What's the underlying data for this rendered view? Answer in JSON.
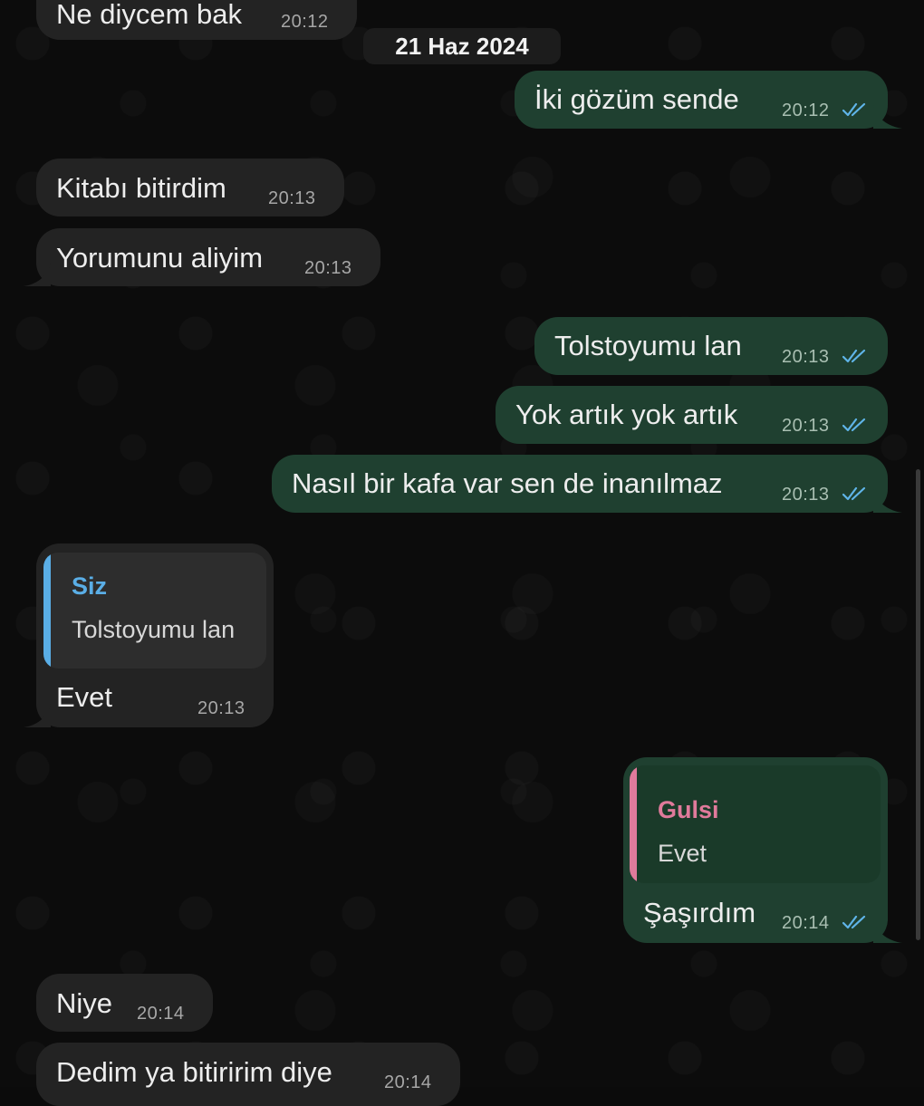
{
  "date_separator": "21 Haz 2024",
  "messages": [
    {
      "text": "Ne diycem bak",
      "time": "20:12"
    },
    {
      "text": "İki gözüm sende",
      "time": "20:12"
    },
    {
      "text": "Kitabı bitirdim",
      "time": "20:13"
    },
    {
      "text": "Yorumunu aliyim",
      "time": "20:13"
    },
    {
      "text": "Tolstoyumu lan",
      "time": "20:13"
    },
    {
      "text": "Yok artık yok artık",
      "time": "20:13"
    },
    {
      "text": "Nasıl bir kafa var sen de inanılmaz",
      "time": "20:13"
    },
    {
      "text": "Evet",
      "time": "20:13",
      "reply_name": "Siz",
      "reply_text": "Tolstoyumu lan"
    },
    {
      "text": "Şaşırdım",
      "time": "20:14",
      "reply_name": "Gulsi",
      "reply_text": "Evet"
    },
    {
      "text": "Niye",
      "time": "20:14"
    },
    {
      "text": "Dedim ya bitiririm diye",
      "time": "20:14"
    }
  ],
  "colors": {
    "incoming_bubble": "#232323",
    "outgoing_bubble": "#1f4030",
    "read_ticks": "#5fb4e8",
    "reply_accent_siz": "#5aaee6",
    "reply_accent_gulsi": "#e07a9b"
  },
  "icons": {
    "read_status": "double-check-icon"
  }
}
